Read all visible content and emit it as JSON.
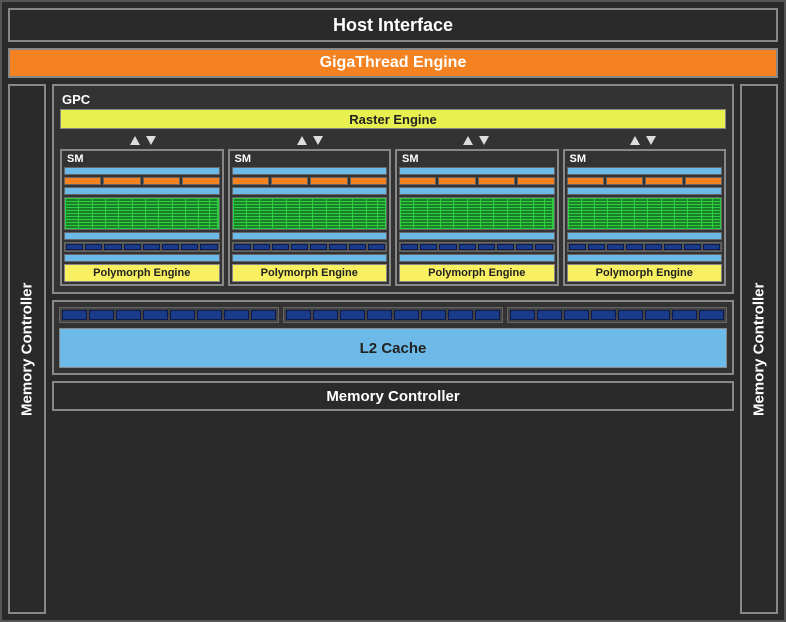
{
  "host_interface": "Host Interface",
  "gigathread": "GigaThread Engine",
  "mem_ctrl_left": "Memory Controller",
  "mem_ctrl_right": "Memory Controller",
  "mem_ctrl_bottom": "Memory Controller",
  "gpc": {
    "label": "GPC",
    "raster": "Raster Engine",
    "sm_count": 4,
    "sm": {
      "label": "SM",
      "orange_segs": 4,
      "core_rows": 10,
      "core_cols": 12,
      "dark_segs": 8,
      "polymorph": "Polymorph Engine"
    }
  },
  "l2": "L2 Cache",
  "cache_groups": 3,
  "cache_segs_per_group": 8
}
